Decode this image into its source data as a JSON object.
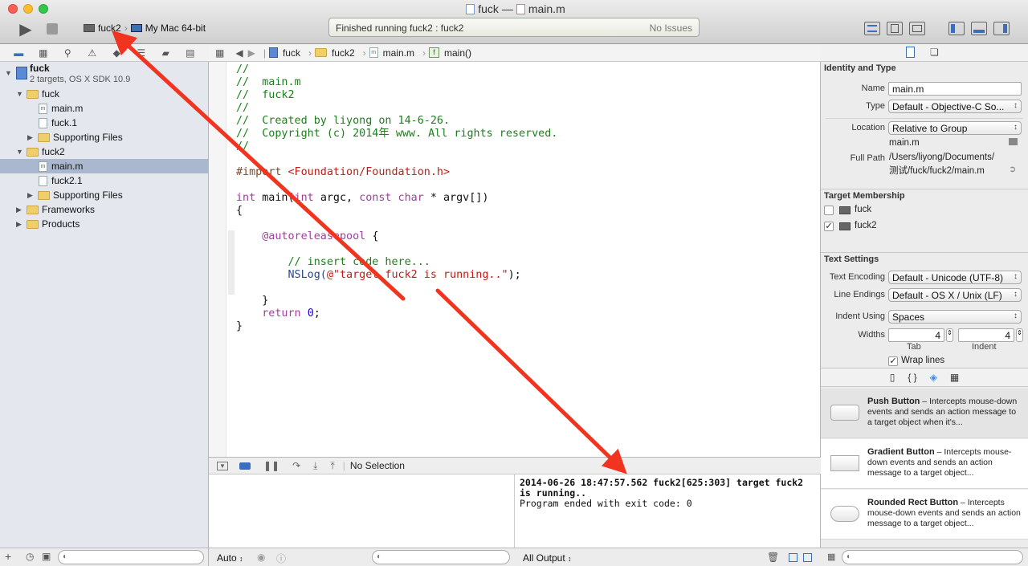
{
  "window": {
    "title_project": "fuck",
    "title_separator": "—",
    "title_file": "main.m"
  },
  "toolbar": {
    "scheme": "fuck2",
    "destination": "My Mac 64-bit",
    "activity_status": "Finished running fuck2 : fuck2",
    "issues": "No Issues"
  },
  "navigator": {
    "project_name": "fuck",
    "project_subtitle": "2 targets, OS X SDK 10.9",
    "items": [
      {
        "label": "fuck"
      },
      {
        "label": "main.m"
      },
      {
        "label": "fuck.1"
      },
      {
        "label": "Supporting Files"
      },
      {
        "label": "fuck2"
      },
      {
        "label": "main.m"
      },
      {
        "label": "fuck2.1"
      },
      {
        "label": "Supporting Files"
      },
      {
        "label": "Frameworks"
      },
      {
        "label": "Products"
      }
    ]
  },
  "jumpbar": {
    "crumbs": [
      "fuck",
      "fuck2",
      "main.m",
      "main()"
    ]
  },
  "editor": {
    "lines": [
      "//",
      "//  main.m",
      "//  fuck2",
      "//",
      "//  Created by liyong on 14-6-26.",
      "//  Copyright (c) 2014年 www. All rights reserved.",
      "//",
      "",
      "#import",
      "<Foundation/Foundation.h>",
      "int",
      "main(",
      "int",
      "argc,",
      "const char",
      "* argv[])",
      "{",
      "@autoreleasepool",
      "{",
      "// insert code here...",
      "NSLog(",
      "@\"target fuck2 is running..\"",
      ");",
      "}",
      "return",
      "0",
      ";",
      "}"
    ]
  },
  "debug": {
    "selection": "No Selection",
    "auto_label": "Auto",
    "output_label": "All Output",
    "console_line1": "2014-06-26 18:47:57.562 fuck2[625:303] target fuck2 is running..",
    "console_line2": "Program ended with exit code: 0"
  },
  "inspector": {
    "identity_header": "Identity and Type",
    "name_label": "Name",
    "name_value": "main.m",
    "type_label": "Type",
    "type_value": "Default - Objective-C So...",
    "location_label": "Location",
    "location_value": "Relative to Group",
    "location_file": "main.m",
    "fullpath_label": "Full Path",
    "fullpath_line1": "/Users/liyong/Documents/",
    "fullpath_line2": "测试/fuck/fuck2/main.m",
    "membership_header": "Target Membership",
    "targets": [
      {
        "name": "fuck",
        "checked": false
      },
      {
        "name": "fuck2",
        "checked": true
      }
    ],
    "text_header": "Text Settings",
    "encoding_label": "Text Encoding",
    "encoding_value": "Default - Unicode (UTF-8)",
    "endings_label": "Line Endings",
    "endings_value": "Default - OS X / Unix (LF)",
    "indent_label": "Indent Using",
    "indent_value": "Spaces",
    "widths_label": "Widths",
    "tab_width": "4",
    "indent_width": "4",
    "tab_caption": "Tab",
    "indent_caption": "Indent",
    "wrap_label": "Wrap lines",
    "library": [
      {
        "title": "Push Button",
        "desc": " – Intercepts mouse-down events and sends an action message to a target object when it's..."
      },
      {
        "title": "Gradient Button",
        "desc": " – Intercepts mouse-down events and sends an action message to a target object..."
      },
      {
        "title": "Rounded Rect Button",
        "desc": " – Intercepts mouse-down events and sends an action message to a target object..."
      }
    ]
  },
  "colors": {
    "selection": "#a9b8cf",
    "comment": "#1d7e1d",
    "keyword": "#a33ba0",
    "string": "#c41a16",
    "annotation_arrow": "#f0341f"
  }
}
